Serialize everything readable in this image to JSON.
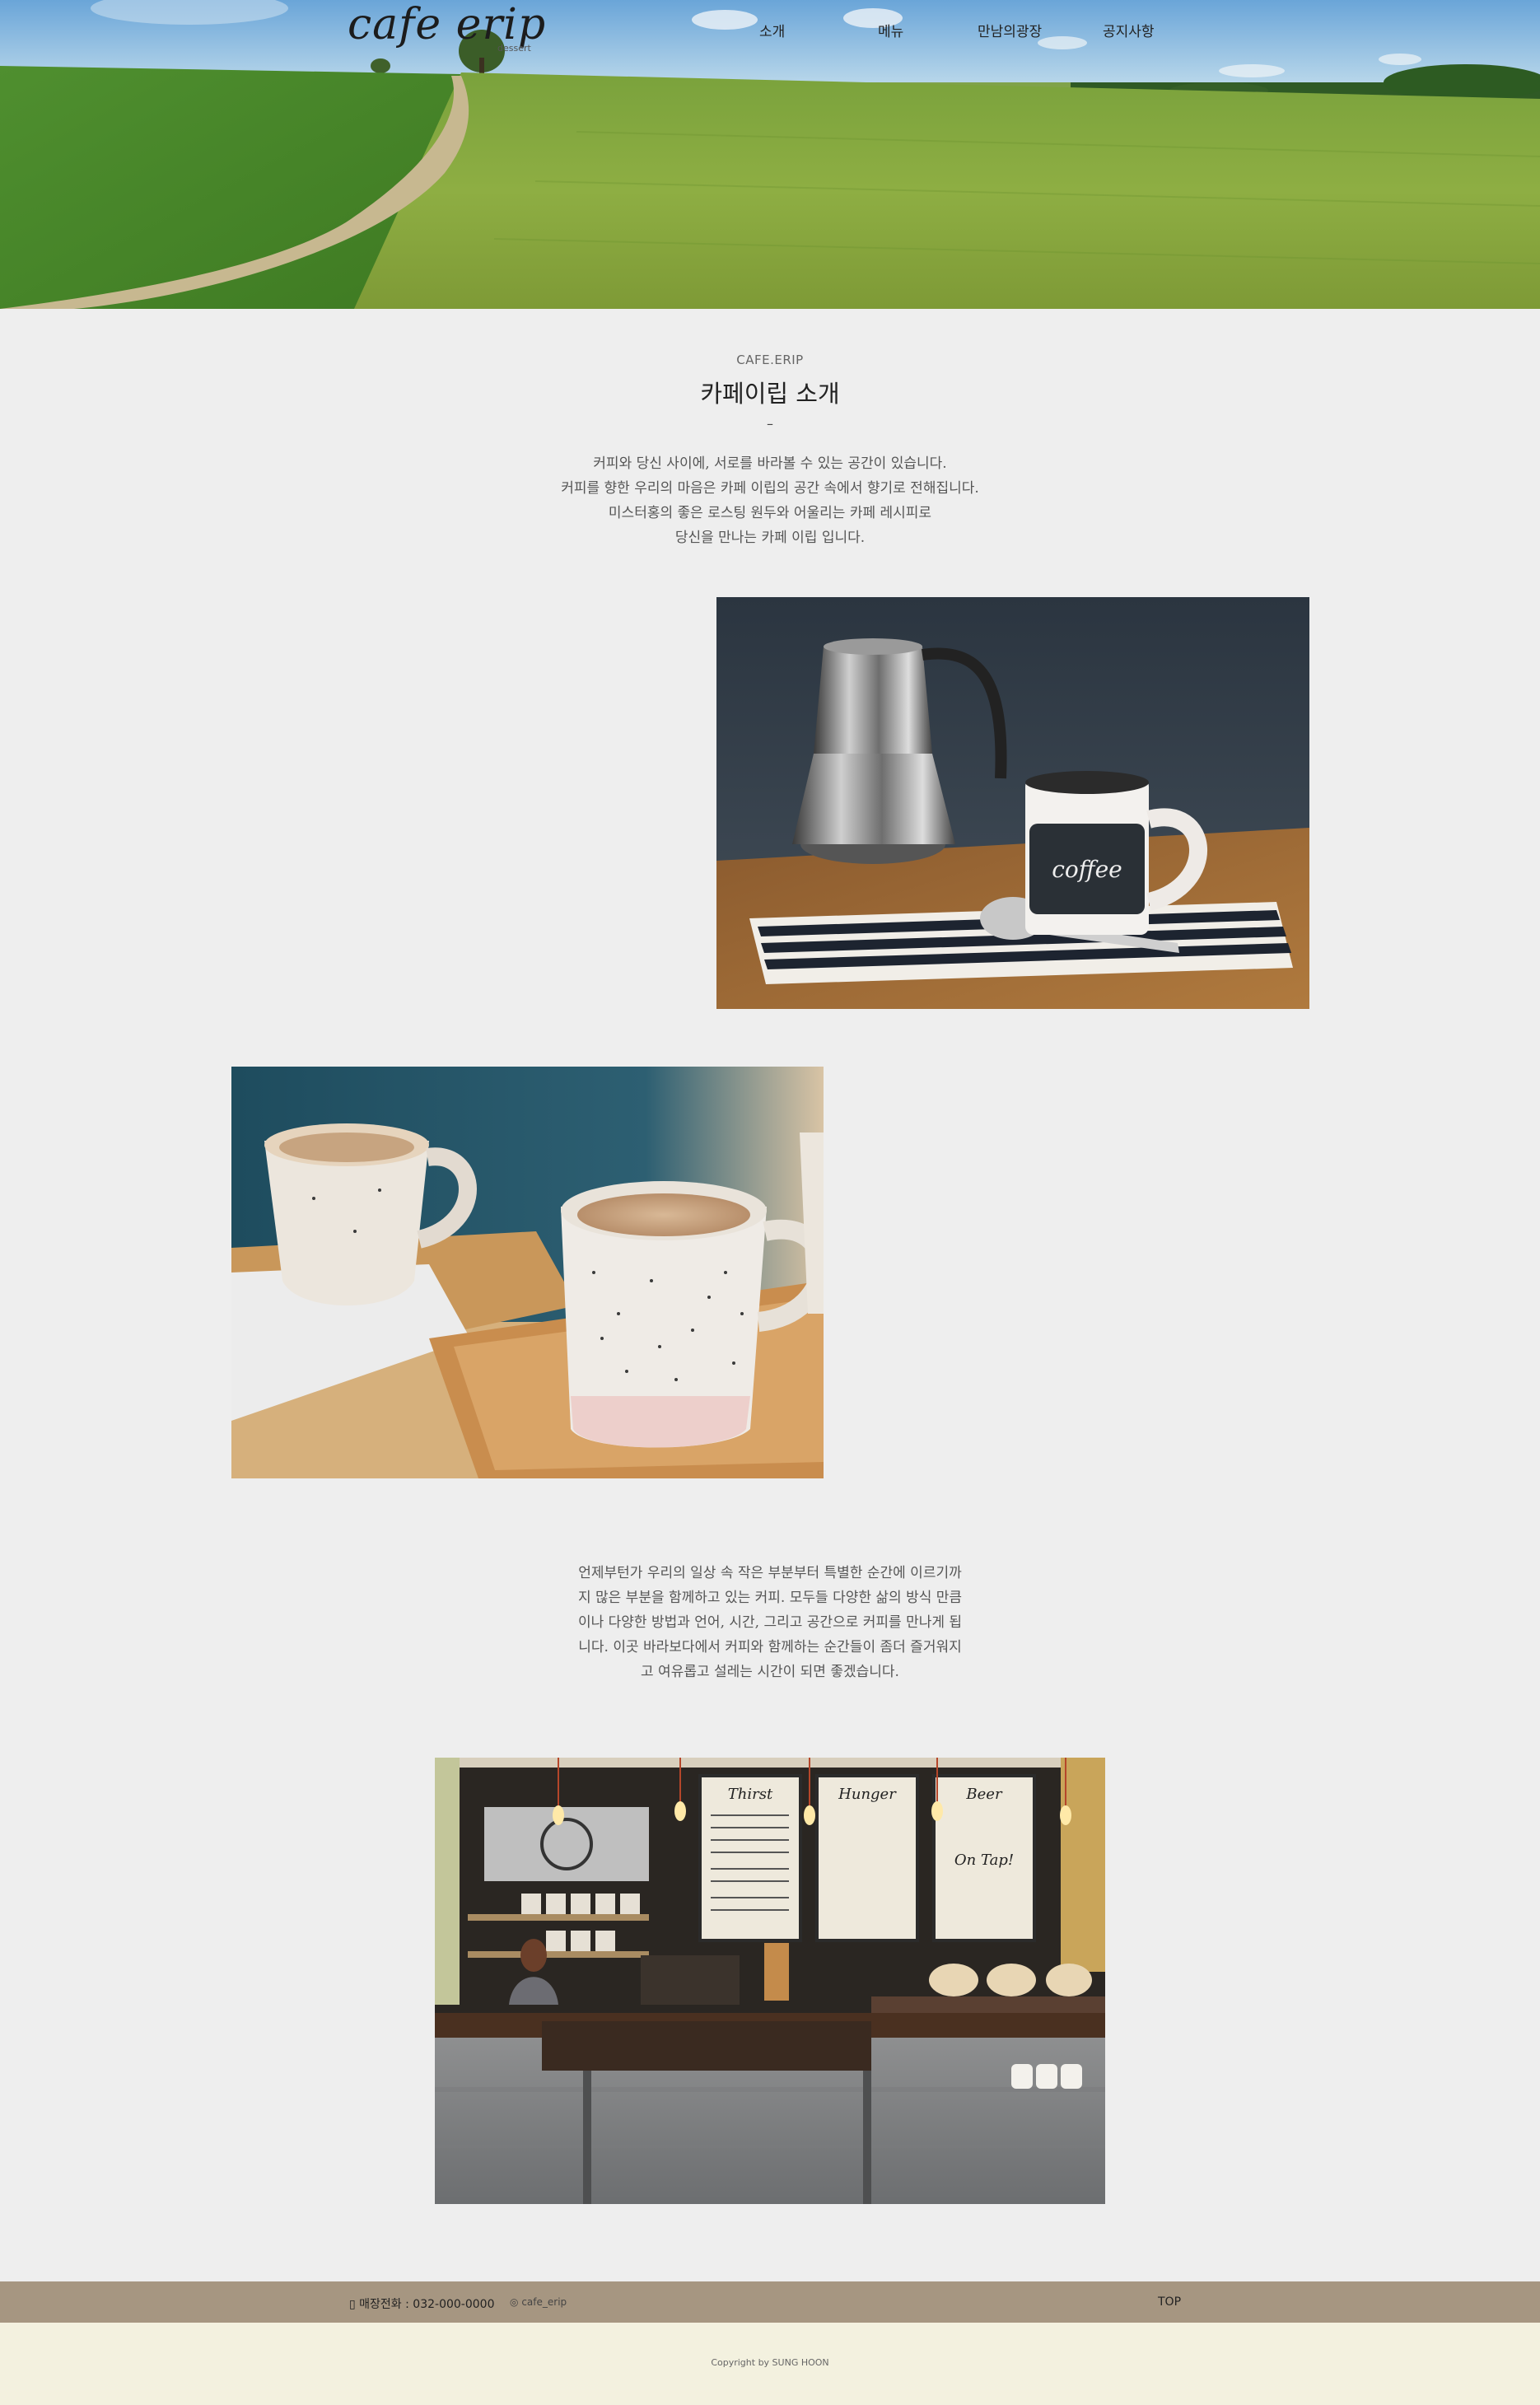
{
  "header": {
    "logo": "cafe erip",
    "logo_sub": "dessert",
    "nav": [
      "소개",
      "메뉴",
      "만남의광장",
      "공지사항"
    ]
  },
  "intro": {
    "eyebrow": "CAFE.ERIP",
    "title": "카페이립 소개",
    "dash": "–",
    "lines": [
      "커피와 당신 사이에, 서로를 바라볼 수 있는 공간이 있습니다.",
      "커피를 향한 우리의 마음은 카페 이립의 공간 속에서 향기로 전해집니다.",
      "미스터홍의 좋은 로스팅 원두와 어울리는 카페 레시피로",
      "당신을 만나는 카페 이립 입니다."
    ]
  },
  "photos": {
    "photo1_text": "coffee",
    "menu_boards": [
      "Thirst",
      "Hunger",
      "Beer"
    ],
    "beer_sub": "On Tap!"
  },
  "story": {
    "lines": [
      "언제부턴가 우리의 일상 속 작은 부분부터 특별한 순간에 이르기까",
      "지 많은 부분을 함께하고 있는 커피. 모두들 다양한 삶의 방식 만큼",
      "이나 다양한 방법과 언어, 시간, 그리고 공간으로 커피를 만나게 됩",
      "니다. 이곳 바라보다에서 커피와 함께하는 순간들이 좀더 즐거워지",
      "고 여유롭고 설레는 시간이 되면 좋겠습니다."
    ]
  },
  "footer": {
    "phone": "매장전화 : 032-000-0000",
    "instagram": "cafe_erip",
    "top": "TOP",
    "copyright": "Copyright by SUNG HOON"
  }
}
